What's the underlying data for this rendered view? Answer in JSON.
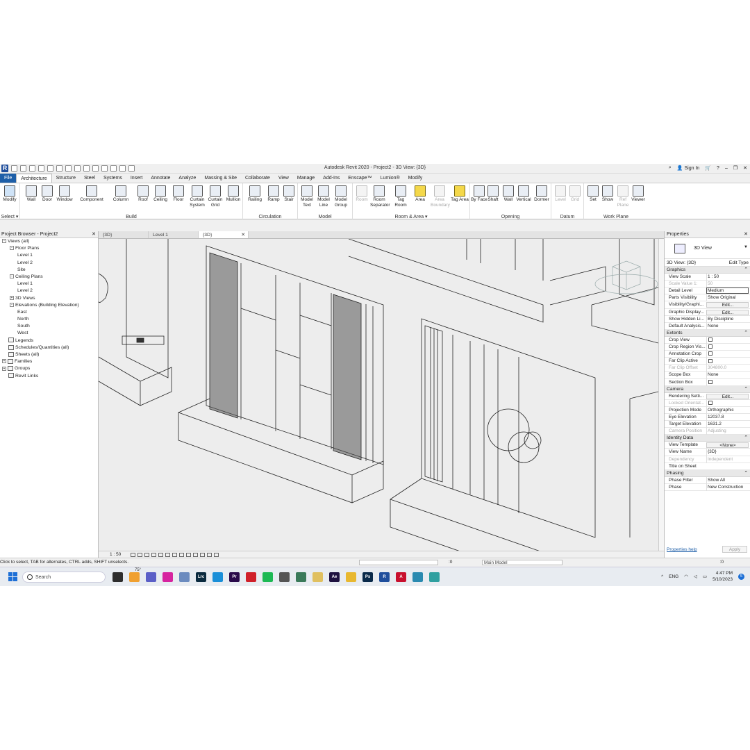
{
  "titlebar": {
    "title": "Autodesk Revit 2020 - Project2 - 3D View: {3D}",
    "sign_in": "Sign In"
  },
  "tabs": [
    "File",
    "Architecture",
    "Structure",
    "Steel",
    "Systems",
    "Insert",
    "Annotate",
    "Analyze",
    "Massing & Site",
    "Collaborate",
    "View",
    "Manage",
    "Add-Ins",
    "Enscape™",
    "Lumion®",
    "Modify"
  ],
  "ribbon": {
    "select_label": "Select ▾",
    "groups": {
      "build": "Build",
      "circulation": "Circulation",
      "model": "Model",
      "room_area": "Room & Area ▾",
      "opening": "Opening",
      "datum": "Datum",
      "work_plane": "Work Plane"
    },
    "tools": {
      "modify": "Modify",
      "wall": "Wall",
      "door": "Door",
      "window": "Window",
      "component": "Component",
      "column": "Column",
      "roof": "Roof",
      "ceiling": "Ceiling",
      "floor": "Floor",
      "curtain_system": "Curtain System",
      "curtain_grid": "Curtain Grid",
      "mullion": "Mullion",
      "railing": "Railing",
      "ramp": "Ramp",
      "stair": "Stair",
      "model_text": "Model Text",
      "model_line": "Model Line",
      "model_group": "Model Group",
      "room": "Room",
      "room_separator": "Room Separator",
      "tag_room": "Tag Room",
      "area": "Area",
      "area_boundary": "Area Boundary",
      "tag_area": "Tag Area",
      "by_face": "By Face",
      "shaft": "Shaft",
      "wall_opening": "Wall",
      "vertical": "Vertical",
      "dormer": "Dormer",
      "level": "Level",
      "grid": "Grid",
      "set": "Set",
      "show": "Show",
      "ref_plane": "Ref Plane",
      "viewer": "Viewer"
    }
  },
  "browser": {
    "title": "Project Browser - Project2",
    "items": [
      {
        "label": "Views (all)",
        "indent": 0,
        "tog": "-"
      },
      {
        "label": "Floor Plans",
        "indent": 1,
        "tog": "-"
      },
      {
        "label": "Level 1",
        "indent": 2,
        "tog": ""
      },
      {
        "label": "Level 2",
        "indent": 2,
        "tog": ""
      },
      {
        "label": "Site",
        "indent": 2,
        "tog": ""
      },
      {
        "label": "Ceiling Plans",
        "indent": 1,
        "tog": "-"
      },
      {
        "label": "Level 1",
        "indent": 2,
        "tog": ""
      },
      {
        "label": "Level 2",
        "indent": 2,
        "tog": ""
      },
      {
        "label": "3D Views",
        "indent": 1,
        "tog": "+"
      },
      {
        "label": "Elevations (Building Elevation)",
        "indent": 1,
        "tog": "-"
      },
      {
        "label": "East",
        "indent": 2,
        "tog": ""
      },
      {
        "label": "North",
        "indent": 2,
        "tog": ""
      },
      {
        "label": "South",
        "indent": 2,
        "tog": ""
      },
      {
        "label": "West",
        "indent": 2,
        "tog": ""
      },
      {
        "label": "Legends",
        "indent": 0,
        "tog": "",
        "icon": true
      },
      {
        "label": "Schedules/Quantities (all)",
        "indent": 0,
        "tog": "",
        "icon": true
      },
      {
        "label": "Sheets (all)",
        "indent": 0,
        "tog": "",
        "icon": true
      },
      {
        "label": "Families",
        "indent": 0,
        "tog": "+",
        "icon": true
      },
      {
        "label": "Groups",
        "indent": 0,
        "tog": "+",
        "icon": true
      },
      {
        "label": "Revit Links",
        "indent": 0,
        "tog": "",
        "icon": true
      }
    ]
  },
  "viewtabs": [
    "{3D}",
    "Level 1",
    "{3D}"
  ],
  "viewbar": {
    "scale": "1 : 50"
  },
  "properties": {
    "title": "Properties",
    "type_name": "3D View",
    "instance": "3D View: {3D}",
    "edit_type": "Edit Type",
    "sections": [
      {
        "name": "Graphics",
        "rows": [
          {
            "n": "View Scale",
            "v": "1 : 50"
          },
          {
            "n": "Scale Value    1:",
            "v": "50",
            "dim": true
          },
          {
            "n": "Detail Level",
            "v": "Medium",
            "box": true
          },
          {
            "n": "Parts Visibility",
            "v": "Show Original"
          },
          {
            "n": "Visibility/Graphi...",
            "v": "Edit...",
            "btn": true
          },
          {
            "n": "Graphic Display...",
            "v": "Edit...",
            "btn": true
          },
          {
            "n": "Show Hidden Li...",
            "v": "By Discipline"
          },
          {
            "n": "Default Analysis...",
            "v": "None"
          }
        ]
      },
      {
        "name": "Extents",
        "rows": [
          {
            "n": "Crop View",
            "v": "",
            "cb": true
          },
          {
            "n": "Crop Region Vis...",
            "v": "",
            "cb": true
          },
          {
            "n": "Annotation Crop",
            "v": "",
            "cb": true
          },
          {
            "n": "Far Clip Active",
            "v": "",
            "cb": true
          },
          {
            "n": "Far Clip Offset",
            "v": "304800.0",
            "dim": true
          },
          {
            "n": "Scope Box",
            "v": "None"
          },
          {
            "n": "Section Box",
            "v": "",
            "cb": true
          }
        ]
      },
      {
        "name": "Camera",
        "rows": [
          {
            "n": "Rendering Setti...",
            "v": "Edit...",
            "btn": true
          },
          {
            "n": "Locked Orientat...",
            "v": "",
            "dim": true,
            "cb": true
          },
          {
            "n": "Projection Mode",
            "v": "Orthographic"
          },
          {
            "n": "Eye Elevation",
            "v": "12037.8"
          },
          {
            "n": "Target Elevation",
            "v": "1631.2"
          },
          {
            "n": "Camera Position",
            "v": "Adjusting",
            "dim": true
          }
        ]
      },
      {
        "name": "Identity Data",
        "rows": [
          {
            "n": "View Template",
            "v": "<None>",
            "btn": true
          },
          {
            "n": "View Name",
            "v": "{3D}"
          },
          {
            "n": "Dependency",
            "v": "Independent",
            "dim": true
          },
          {
            "n": "Title on Sheet",
            "v": ""
          }
        ]
      },
      {
        "name": "Phasing",
        "rows": [
          {
            "n": "Phase Filter",
            "v": "Show All"
          },
          {
            "n": "Phase",
            "v": "New Construction"
          }
        ]
      }
    ],
    "help": "Properties help",
    "apply": "Apply"
  },
  "status": {
    "message": "Click to select, TAB for alternates, CTRL adds, SHIFT unselects.",
    "zero": ":0",
    "main_model": "Main Model",
    "zero2": ":0"
  },
  "taskbar": {
    "search": "Search",
    "weather": "75°",
    "lang": "ENG",
    "time": "4:47 PM",
    "date": "5/10/2023",
    "notif": "5",
    "apps": [
      "Lrc",
      "Pr",
      "Ae",
      "Ps",
      "R",
      "A"
    ]
  },
  "colors": {
    "file_tab": "#1e5fa8",
    "windows_blue": "#1d6fd6"
  }
}
